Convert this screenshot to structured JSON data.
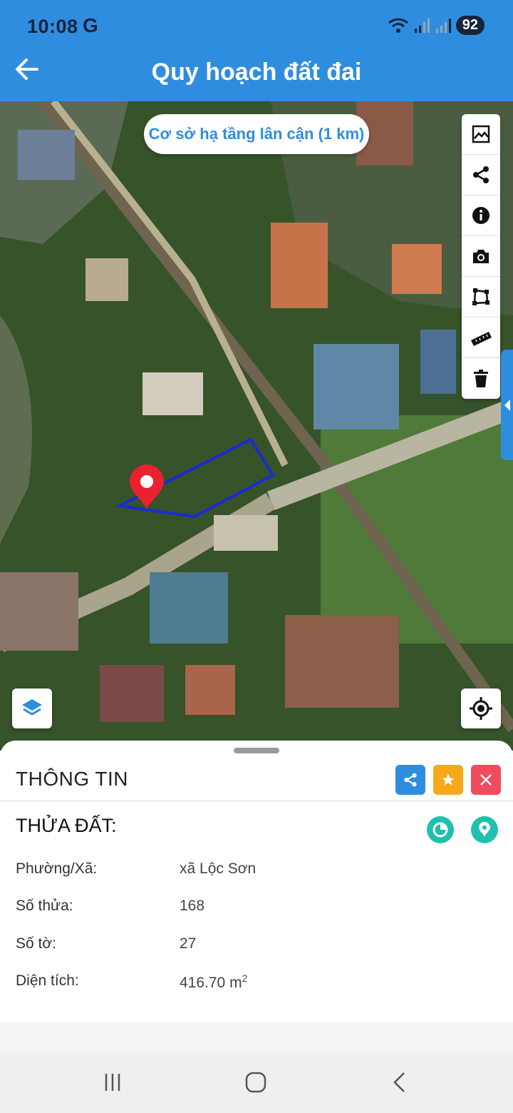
{
  "status": {
    "time": "10:08",
    "carrier_logo": "G",
    "battery": "92",
    "icons": [
      "wifi-icon",
      "signal-icon",
      "signal-icon"
    ]
  },
  "header": {
    "title": "Quy hoạch đất đai",
    "back_icon": "arrow-left-icon"
  },
  "map": {
    "nearby_chip": "Cơ sở hạ tầng lân cận (1 km)",
    "tools": [
      "image-icon",
      "share-icon",
      "info-icon",
      "camera-icon",
      "polygon-icon",
      "ruler-icon",
      "trash-icon"
    ],
    "layers_icon": "layers-icon",
    "locate_icon": "crosshair-icon",
    "marker_color": "#e8222e",
    "parcel_color": "#1a2bd6"
  },
  "sheet": {
    "title": "THÔNG TIN",
    "section_title": "THỬA ĐẤT:",
    "actions": [
      "share-icon",
      "star-icon",
      "close-icon"
    ],
    "rows": [
      {
        "label": "Phường/Xã:",
        "value": "xã Lộc Sơn"
      },
      {
        "label": "Số thửa:",
        "value": "168"
      },
      {
        "label": "Số tờ:",
        "value": "27"
      },
      {
        "label": "Diện tích:",
        "value": "416.70 m",
        "unit_sup": "2"
      }
    ]
  },
  "colors": {
    "primary": "#2f8de0",
    "teal": "#1fc0ae",
    "star": "#f7a81b",
    "danger": "#ef4b5f"
  }
}
